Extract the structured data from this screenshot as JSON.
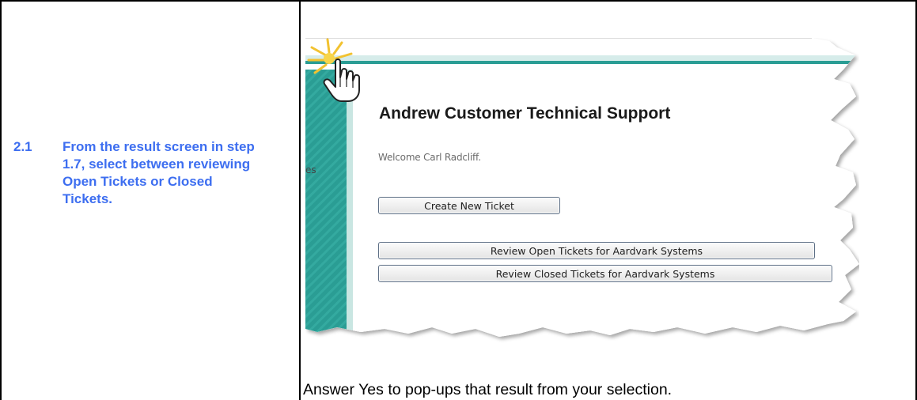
{
  "step": {
    "number": "2.1",
    "instruction": "From the result screen in step 1.7, select between reviewing Open Tickets or Closed Tickets."
  },
  "screenshot": {
    "sidebar_fragment": "es",
    "heading": "Andrew Customer Technical Support",
    "welcome_text": "Welcome Carl Radcliff.",
    "buttons": {
      "create": "Create New Ticket",
      "open": "Review Open Tickets for Aardvark Systems",
      "closed": "Review Closed Tickets for Aardvark Systems"
    },
    "colors": {
      "sidebar_teal": "#2a9d94",
      "header_bar": "#d6ecea",
      "step_text": "#3d6ef0"
    }
  },
  "note": "Answer Yes to pop-ups that result from your selection."
}
